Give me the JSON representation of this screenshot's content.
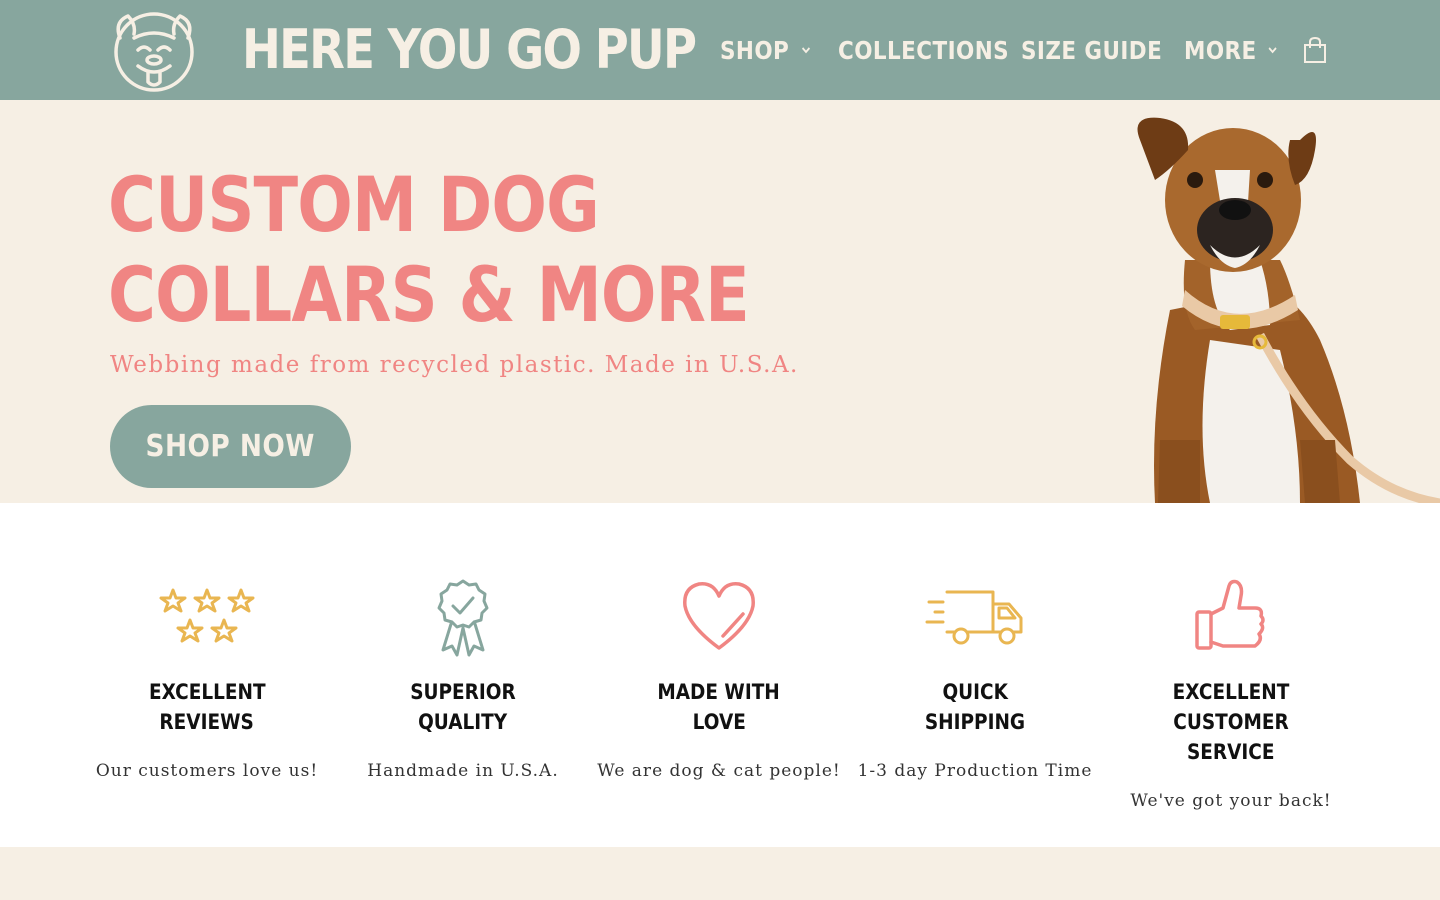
{
  "header": {
    "brand": "HERE YOU GO PUP",
    "logo_icon": "pug-logo-icon",
    "nav": [
      {
        "label": "SHOP",
        "has_dropdown": true
      },
      {
        "label": "COLLECTIONS",
        "has_dropdown": false
      },
      {
        "label": "SIZE GUIDE",
        "has_dropdown": false
      },
      {
        "label": "MORE",
        "has_dropdown": true
      }
    ],
    "cart_icon": "shopping-bag-icon"
  },
  "hero": {
    "title_line1": "CUSTOM DOG",
    "title_line2": "COLLARS & MORE",
    "subtitle": "Webbing made from recycled plastic. Made in U.S.A.",
    "cta_label": "SHOP NOW",
    "image": "boxer-dog-with-collar-and-leash"
  },
  "features": [
    {
      "icon": "five-stars-icon",
      "title_line1": "EXCELLENT",
      "title_line2": "REVIEWS",
      "desc": "Our customers love us!"
    },
    {
      "icon": "award-ribbon-check-icon",
      "title_line1": "SUPERIOR",
      "title_line2": "QUALITY",
      "desc": "Handmade in U.S.A."
    },
    {
      "icon": "heart-icon",
      "title_line1": "MADE WITH",
      "title_line2": "LOVE",
      "desc": "We are dog & cat people!"
    },
    {
      "icon": "delivery-truck-icon",
      "title_line1": "QUICK",
      "title_line2": "SHIPPING",
      "desc": "1-3 day Production Time"
    },
    {
      "icon": "thumbs-up-icon",
      "title_line1": "EXCELLENT CUSTOMER",
      "title_line2": "SERVICE",
      "desc": "We've got your back!"
    }
  ],
  "colors": {
    "header_bg": "#87a69e",
    "cream": "#f6efe4",
    "coral": "#f08583",
    "gold": "#e9b651",
    "sage": "#87a69e"
  }
}
